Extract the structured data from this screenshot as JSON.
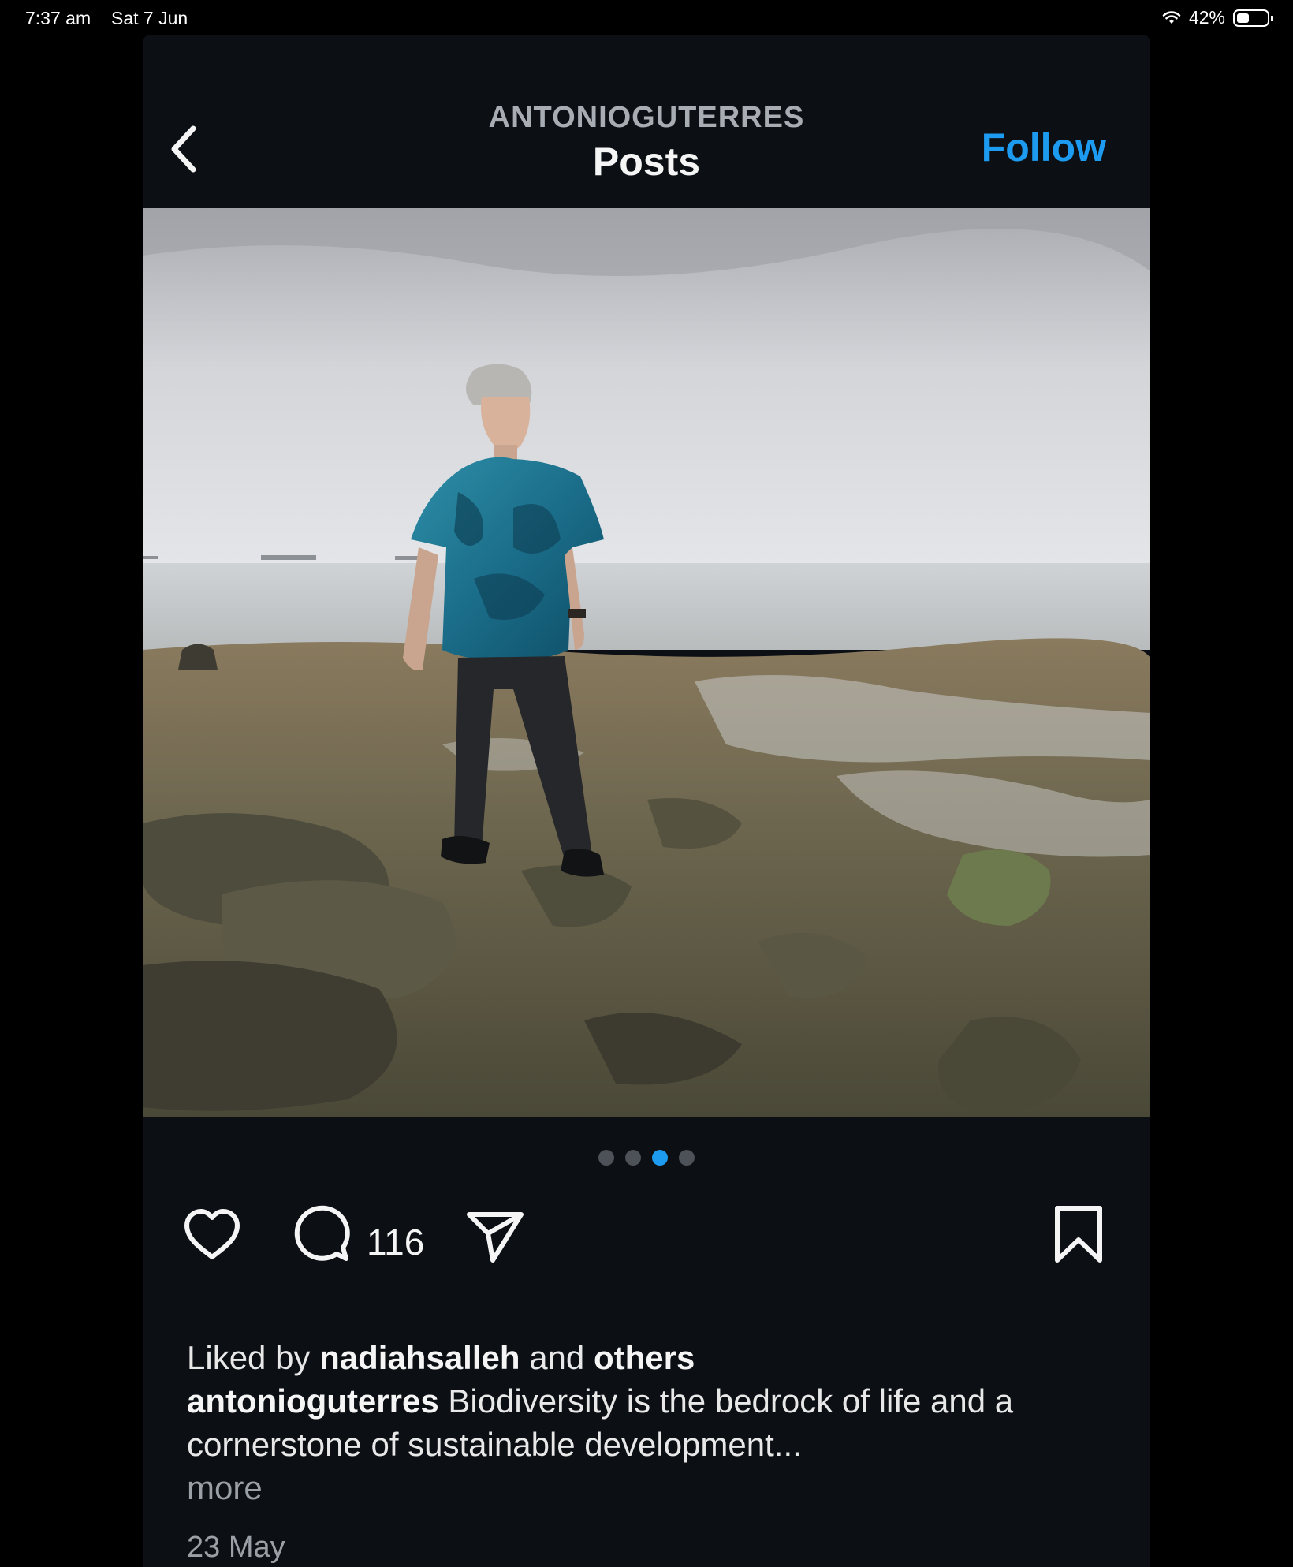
{
  "status_bar": {
    "time": "7:37 am",
    "date": "Sat 7 Jun",
    "battery": "42%",
    "battery_level": 0.42
  },
  "header": {
    "username": "ANTONIOGUTERRES",
    "title": "Posts",
    "follow_label": "Follow",
    "back_icon": "chevron-left-icon"
  },
  "post": {
    "image_alt": "Man in blue patterned shirt standing on rocky shoreline under cloudy sky",
    "carousel": {
      "count": 4,
      "active_index": 2
    },
    "comment_count": "116",
    "liked_by_prefix": "Liked by",
    "liked_by_user": "nadiahsalleh",
    "liked_by_connector": "and",
    "liked_by_others": "others",
    "caption_user": "antonioguterres",
    "caption_text": "Biodiversity is the bedrock of life and a cornerstone of sustainable development...",
    "more_label": "more",
    "date": "23 May"
  },
  "colors": {
    "accent": "#1d9bf0",
    "background": "#0c1015",
    "muted_text": "#9aa0a6"
  }
}
